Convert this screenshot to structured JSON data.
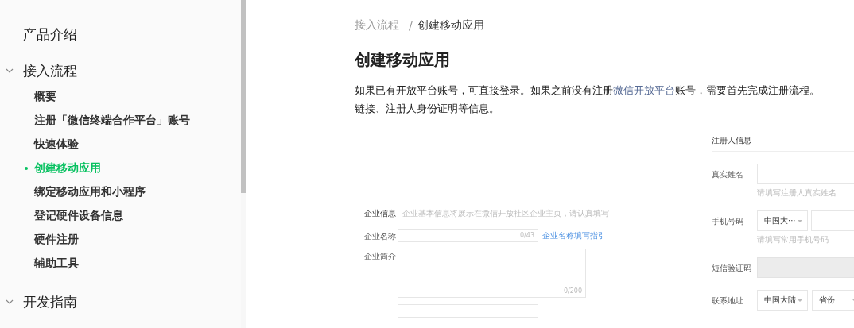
{
  "sidebar": {
    "items": [
      {
        "label": "产品介绍",
        "kind": "leaf"
      },
      {
        "label": "接入流程",
        "kind": "group",
        "expanded": true,
        "children": [
          {
            "label": "概要",
            "selected": false
          },
          {
            "label": "注册「微信终端合作平台」账号",
            "selected": false
          },
          {
            "label": "快速体验",
            "selected": false
          },
          {
            "label": "创建移动应用",
            "selected": true
          },
          {
            "label": "绑定移动应用和小程序",
            "selected": false
          },
          {
            "label": "登记硬件设备信息",
            "selected": false
          },
          {
            "label": "硬件注册",
            "selected": false
          },
          {
            "label": "辅助工具",
            "selected": false
          }
        ]
      },
      {
        "label": "开发指南",
        "kind": "group",
        "expanded": true
      }
    ]
  },
  "breadcrumb": {
    "separator": "/",
    "items": [
      {
        "label": "接入流程",
        "current": false
      },
      {
        "label": "创建移动应用",
        "current": true
      }
    ]
  },
  "title": "创建移动应用",
  "intro": {
    "lines": [
      [
        {
          "kind": "text",
          "text": "如果已有开放平台账号，可直接登录。如果之前没有注册"
        },
        {
          "kind": "link",
          "text": "微信开放平台"
        },
        {
          "kind": "text",
          "text": "账号，需要首先完成注册流程。"
        }
      ],
      [
        {
          "kind": "text",
          "text": "链接、注册人身份证明等信息。"
        }
      ]
    ]
  },
  "figures": [
    {
      "section": "企业信息",
      "hint": "企业基本信息将展示在微信开放社区企业主页，请认真填写",
      "fields": [
        {
          "label": "企业名称",
          "controls": [
            {
              "kind": "input",
              "counter": "0/43"
            }
          ],
          "link": "企业名称填写指引"
        },
        {
          "label": "企业简介",
          "controls": [
            {
              "kind": "textarea",
              "counter": "0/200"
            }
          ]
        },
        {
          "controls": [
            {
              "kind": "input"
            }
          ]
        }
      ]
    },
    {
      "section": "注册人信息",
      "fields": [
        {
          "label": "真实姓名",
          "controls": [
            {
              "kind": "input"
            }
          ],
          "help": "请填写注册人真实姓名"
        },
        {
          "label": "手机号码",
          "controls": [
            {
              "kind": "select",
              "value": "中国大···"
            },
            {
              "kind": "input"
            }
          ],
          "help": "请填写常用手机号码"
        },
        {
          "label": "短信验证码",
          "controls": [
            {
              "kind": "input",
              "disabled": true
            }
          ]
        },
        {
          "label": "联系地址",
          "controls": [
            {
              "kind": "select",
              "value": "中国大陆"
            },
            {
              "kind": "select",
              "value": "省份"
            }
          ]
        }
      ]
    }
  ]
}
